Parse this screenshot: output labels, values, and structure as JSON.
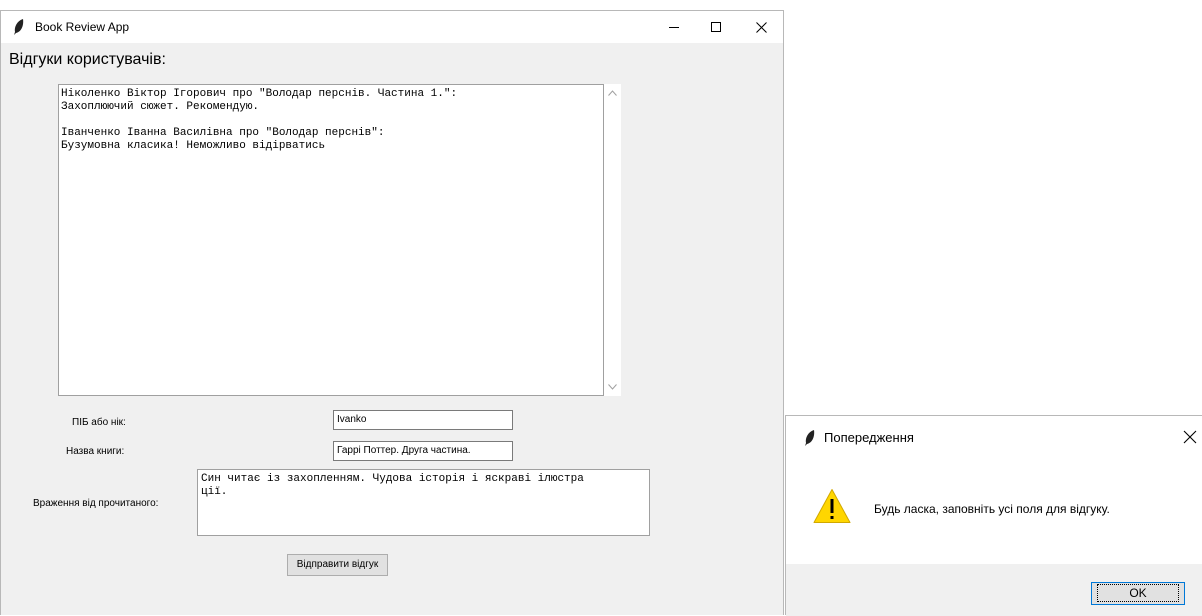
{
  "main_window": {
    "title": "Book Review App",
    "heading": "Відгуки користувачів:",
    "reviews_text": "Ніколенко Віктор Ігорович про \"Володар перснів. Частина 1.\":\nЗахоплюючий сюжет. Рекомендую.\n\nІванченко Іванна Василівна про \"Володар перснів\":\nБузумовна класика! Неможливо відірватись",
    "form": {
      "name_label": "ПІБ або нік:",
      "name_value": "Ivanko",
      "book_label": "Назва книги:",
      "book_value": "Гаррі Поттер. Друга частина.",
      "impression_label": "Враження від прочитаного:",
      "impression_value": "Син читає із захопленням. Чудова історія і яскраві ілюстра\nції.",
      "submit_label": "Відправити відгук"
    },
    "icons": [
      "feather-icon",
      "minimize-icon",
      "maximize-icon",
      "close-icon",
      "scroll-up-arrow-icon",
      "scroll-down-arrow-icon"
    ]
  },
  "dialog": {
    "title": "Попередження",
    "message": "Будь ласка, заповніть усі поля для відгуку.",
    "ok_label": "OK",
    "icons": [
      "feather-icon",
      "close-icon",
      "warning-icon"
    ]
  },
  "colors": {
    "window_bg": "#f0f0f0",
    "warning_yellow": "#ffd600",
    "ok_focus_border": "#0078d7"
  }
}
